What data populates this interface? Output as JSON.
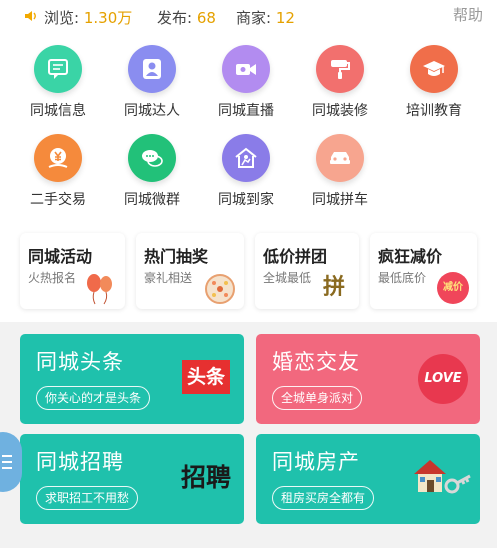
{
  "stats": {
    "views_label": "浏览:",
    "views_value": "1.30万",
    "posts_label": "发布:",
    "posts_value": "68",
    "merchants_label": "商家:",
    "merchants_value": "12",
    "help_label": "帮助"
  },
  "grid": [
    {
      "label": "同城信息",
      "icon": "message-icon",
      "color": "#3ad4a6"
    },
    {
      "label": "同城达人",
      "icon": "user-badge-icon",
      "color": "#8a8df0"
    },
    {
      "label": "同城直播",
      "icon": "video-camera-icon",
      "color": "#b28cf0"
    },
    {
      "label": "同城装修",
      "icon": "paint-roller-icon",
      "color": "#f2706e"
    },
    {
      "label": "培训教育",
      "icon": "graduation-cap-icon",
      "color": "#f06e4a"
    },
    {
      "label": "二手交易",
      "icon": "yen-coin-icon",
      "color": "#f58a3c"
    },
    {
      "label": "同城微群",
      "icon": "chat-bubbles-icon",
      "color": "#22c179"
    },
    {
      "label": "同城到家",
      "icon": "house-delivery-icon",
      "color": "#8a7ce8"
    },
    {
      "label": "同城拼车",
      "icon": "car-icon",
      "color": "#f7a58f"
    }
  ],
  "promos": [
    {
      "title": "同城活动",
      "subtitle": "火热报名",
      "icon": "balloons-icon"
    },
    {
      "title": "热门抽奖",
      "subtitle": "豪礼相送",
      "icon": "prize-wheel-icon"
    },
    {
      "title": "低价拼团",
      "subtitle": "全城最低",
      "icon": "group-buy-icon"
    },
    {
      "title": "疯狂减价",
      "subtitle": "最低底价",
      "icon": "sale-tag-icon"
    }
  ],
  "cards": [
    {
      "title": "同城头条",
      "subtitle": "你关心的才是头条",
      "icon": "headline-logo-icon",
      "color": "#1fc1ac"
    },
    {
      "title": "婚恋交友",
      "subtitle": "全城单身派对",
      "icon": "love-logo-icon",
      "color": "#f2687e"
    },
    {
      "title": "同城招聘",
      "subtitle": "求职招工不用愁",
      "icon": "recruit-logo-icon",
      "color": "#1fc1ac"
    },
    {
      "title": "同城房产",
      "subtitle": "租房买房全都有",
      "icon": "house-key-icon",
      "color": "#1fc1ac"
    }
  ],
  "logos": {
    "headline": "头条",
    "love": "LOVE",
    "recruit": "招聘",
    "group_buy": "拼",
    "sale": "减价"
  }
}
